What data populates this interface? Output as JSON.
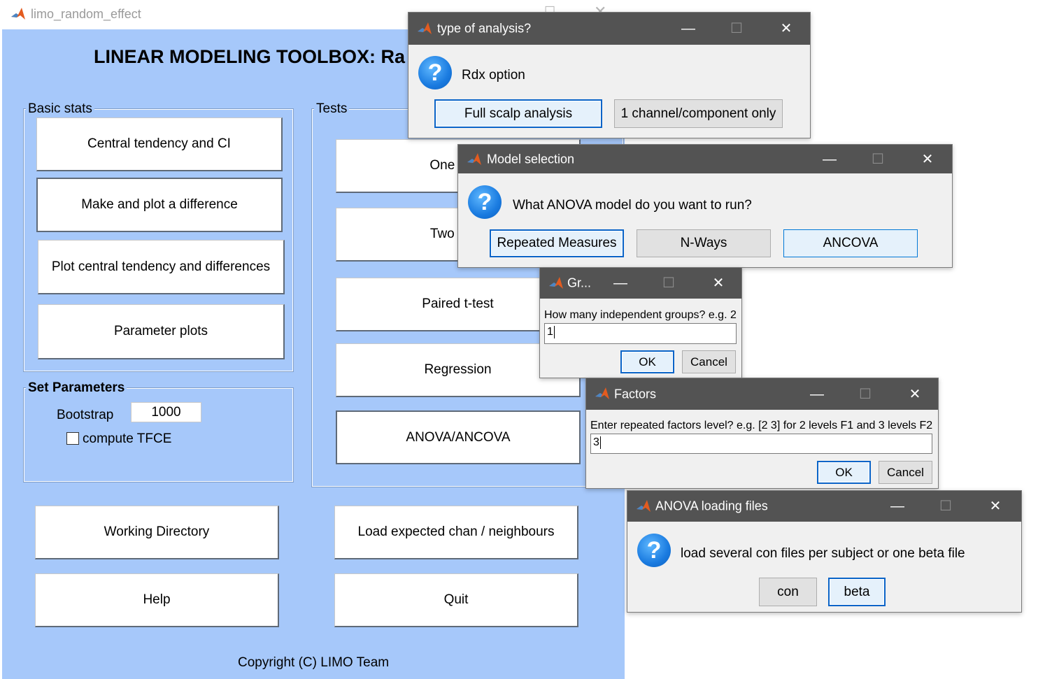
{
  "main_window": {
    "title": "limo_random_effect",
    "heading": "LINEAR MODELING TOOLBOX: Ra",
    "basic_stats": {
      "label": "Basic stats",
      "buttons": [
        "Central tendency and CI",
        "Make and plot a difference",
        "Plot central tendency and differences",
        "Parameter plots"
      ]
    },
    "tests": {
      "label": "Tests",
      "buttons": [
        "One Sam",
        "Two Sam",
        "Paired t-test",
        "Regression",
        "ANOVA/ANCOVA"
      ]
    },
    "set_parameters": {
      "label": "Set Parameters",
      "bootstrap_label": "Bootstrap",
      "bootstrap_value": "1000",
      "tfce_label": "compute TFCE",
      "tfce_checked": false
    },
    "bottom_buttons": {
      "working_directory": "Working Directory",
      "load_chan": "Load expected chan / neighbours",
      "help": "Help",
      "quit": "Quit"
    },
    "copyright": "Copyright (C) LIMO Team"
  },
  "dialog_type": {
    "title": "type of analysis?",
    "question": "Rdx option",
    "buttons": [
      "Full scalp analysis",
      "1 channel/component only"
    ]
  },
  "dialog_model": {
    "title": "Model selection",
    "question": "What ANOVA model do you want to run?",
    "buttons": [
      "Repeated Measures",
      "N-Ways",
      "ANCOVA"
    ]
  },
  "dialog_groups": {
    "title": "Gr...",
    "prompt": "How many independent groups? e.g. 2",
    "value": "1",
    "ok": "OK",
    "cancel": "Cancel"
  },
  "dialog_factors": {
    "title": "Factors",
    "prompt": "Enter repeated factors level? e.g. [2 3] for 2 levels F1 and 3 levels F2",
    "value": "3",
    "ok": "OK",
    "cancel": "Cancel"
  },
  "dialog_loading": {
    "title": "ANOVA loading files",
    "question": "load several con files per subject or one beta file",
    "buttons": [
      "con",
      "beta"
    ]
  },
  "icons": {
    "window_icon": "matlab-icon",
    "question_icon": "question-icon",
    "minimize": "minimize-icon",
    "maximize": "maximize-icon",
    "close": "close-icon"
  },
  "colors": {
    "figure_background": "#a6c8fa",
    "dialog_title_bar": "#535353",
    "focus_border": "#0a64c8"
  }
}
